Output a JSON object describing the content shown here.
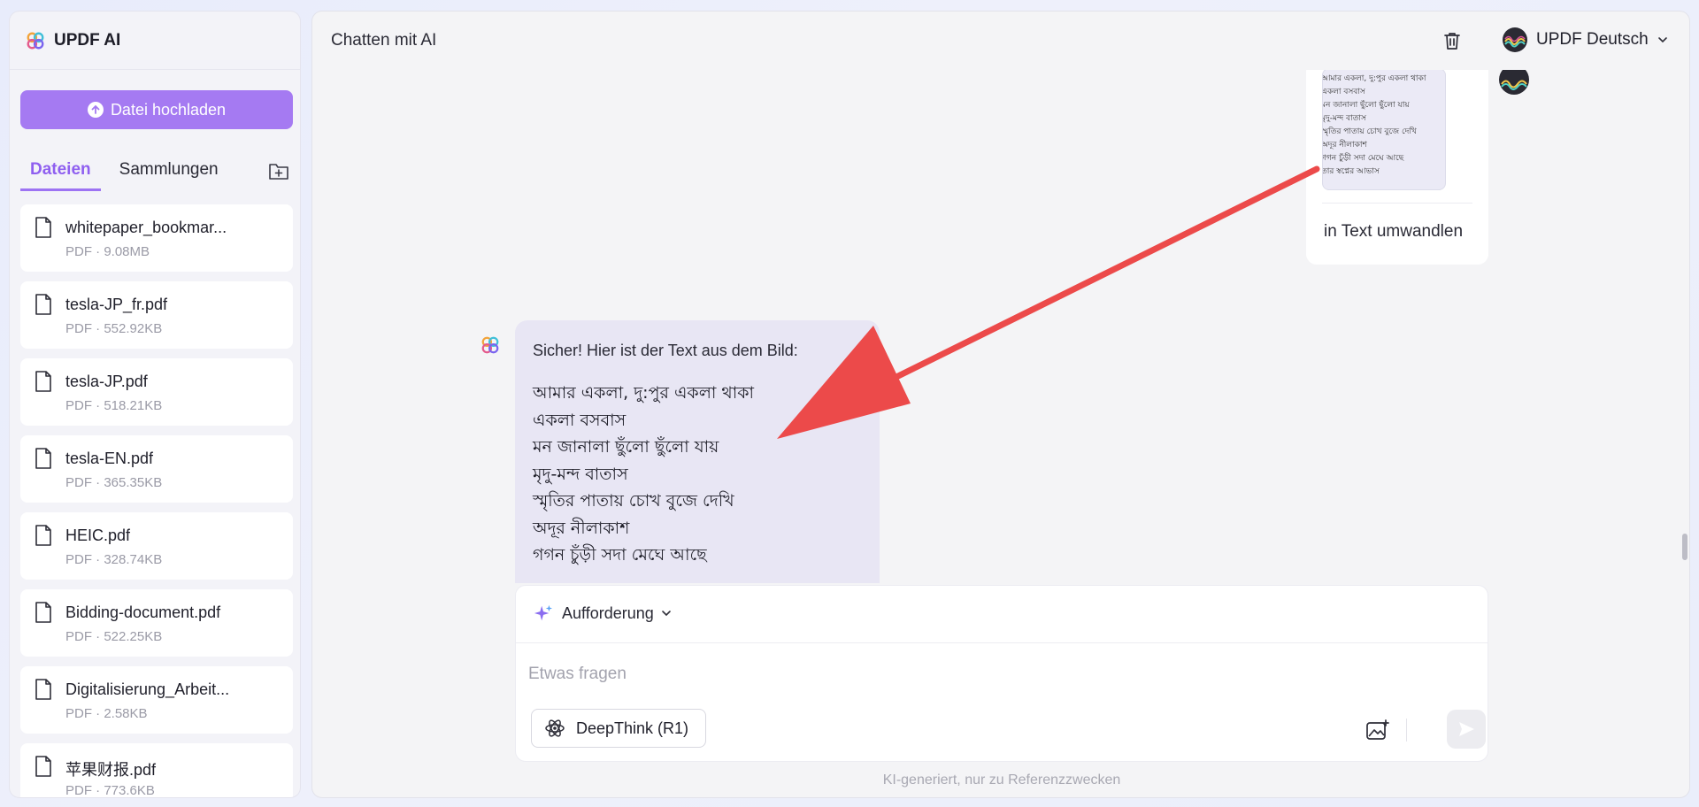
{
  "brand": {
    "name": "UPDF AI"
  },
  "sidebar": {
    "upload_label": "Datei hochladen",
    "tabs": [
      {
        "label": "Dateien",
        "active": true
      },
      {
        "label": "Sammlungen",
        "active": false
      }
    ],
    "files": [
      {
        "name": "whitepaper_bookmar...",
        "meta": "PDF · 9.08MB"
      },
      {
        "name": "tesla-JP_fr.pdf",
        "meta": "PDF · 552.92KB"
      },
      {
        "name": "tesla-JP.pdf",
        "meta": "PDF · 518.21KB"
      },
      {
        "name": "tesla-EN.pdf",
        "meta": "PDF · 365.35KB"
      },
      {
        "name": "HEIC.pdf",
        "meta": "PDF · 328.74KB"
      },
      {
        "name": "Bidding-document.pdf",
        "meta": "PDF · 522.25KB"
      },
      {
        "name": "Digitalisierung_Arbeit...",
        "meta": "PDF · 2.58KB"
      },
      {
        "name": "苹果财报.pdf",
        "meta": "PDF · 773.6KB"
      }
    ]
  },
  "header": {
    "title": "Chatten mit AI",
    "account_name": "UPDF Deutsch"
  },
  "chat": {
    "user_message": {
      "image_text_lines": [
        "আমার একলা, দু:পুর একলা থাকা",
        "একলা বসবাস",
        "মন জানালা ছুঁলো ছুঁলো যায়",
        "মৃদু-মন্দ বাতাস",
        "স্মৃতির পাতায় চোখ বুজে দেখি",
        "অদূর নীলাকাশ",
        "গগন চুঁড়ী সদা মেঘে আছে",
        "তার স্বপ্নের আভাস"
      ],
      "text": "in Text umwandlen"
    },
    "ai_message": {
      "intro": "Sicher! Hier ist der Text aus dem Bild:",
      "lines": [
        "আমার একলা, দু:পুর একলা থাকা",
        "একলা বসবাস",
        "মন জানালা ছুঁলো ছুঁলো যায়",
        "মৃদু-মন্দ বাতাস",
        "স্মৃতির পাতায় চোখ বুজে দেখি",
        "অদূর নীলাকাশ",
        "গগন চুঁড়ী সদা মেঘে আছে"
      ]
    }
  },
  "input": {
    "prompt_label": "Aufforderung",
    "placeholder": "Etwas fragen",
    "value": "",
    "deepthink_label": "DeepThink (R1)"
  },
  "footer_note": "KI-generiert, nur zu Referenzzwecken",
  "colors": {
    "accent": "#a57af2",
    "active_tab": "#8f5ff0",
    "arrow": "#ec4a4a",
    "ai_bubble": "#e8e6f4"
  },
  "icons": [
    "updf-logo-icon",
    "upload-icon",
    "new-folder-icon",
    "file-icon",
    "trash-icon",
    "avatar-icon",
    "chevron-down-icon",
    "sparkle-icon",
    "atom-icon",
    "image-icon",
    "send-icon"
  ]
}
